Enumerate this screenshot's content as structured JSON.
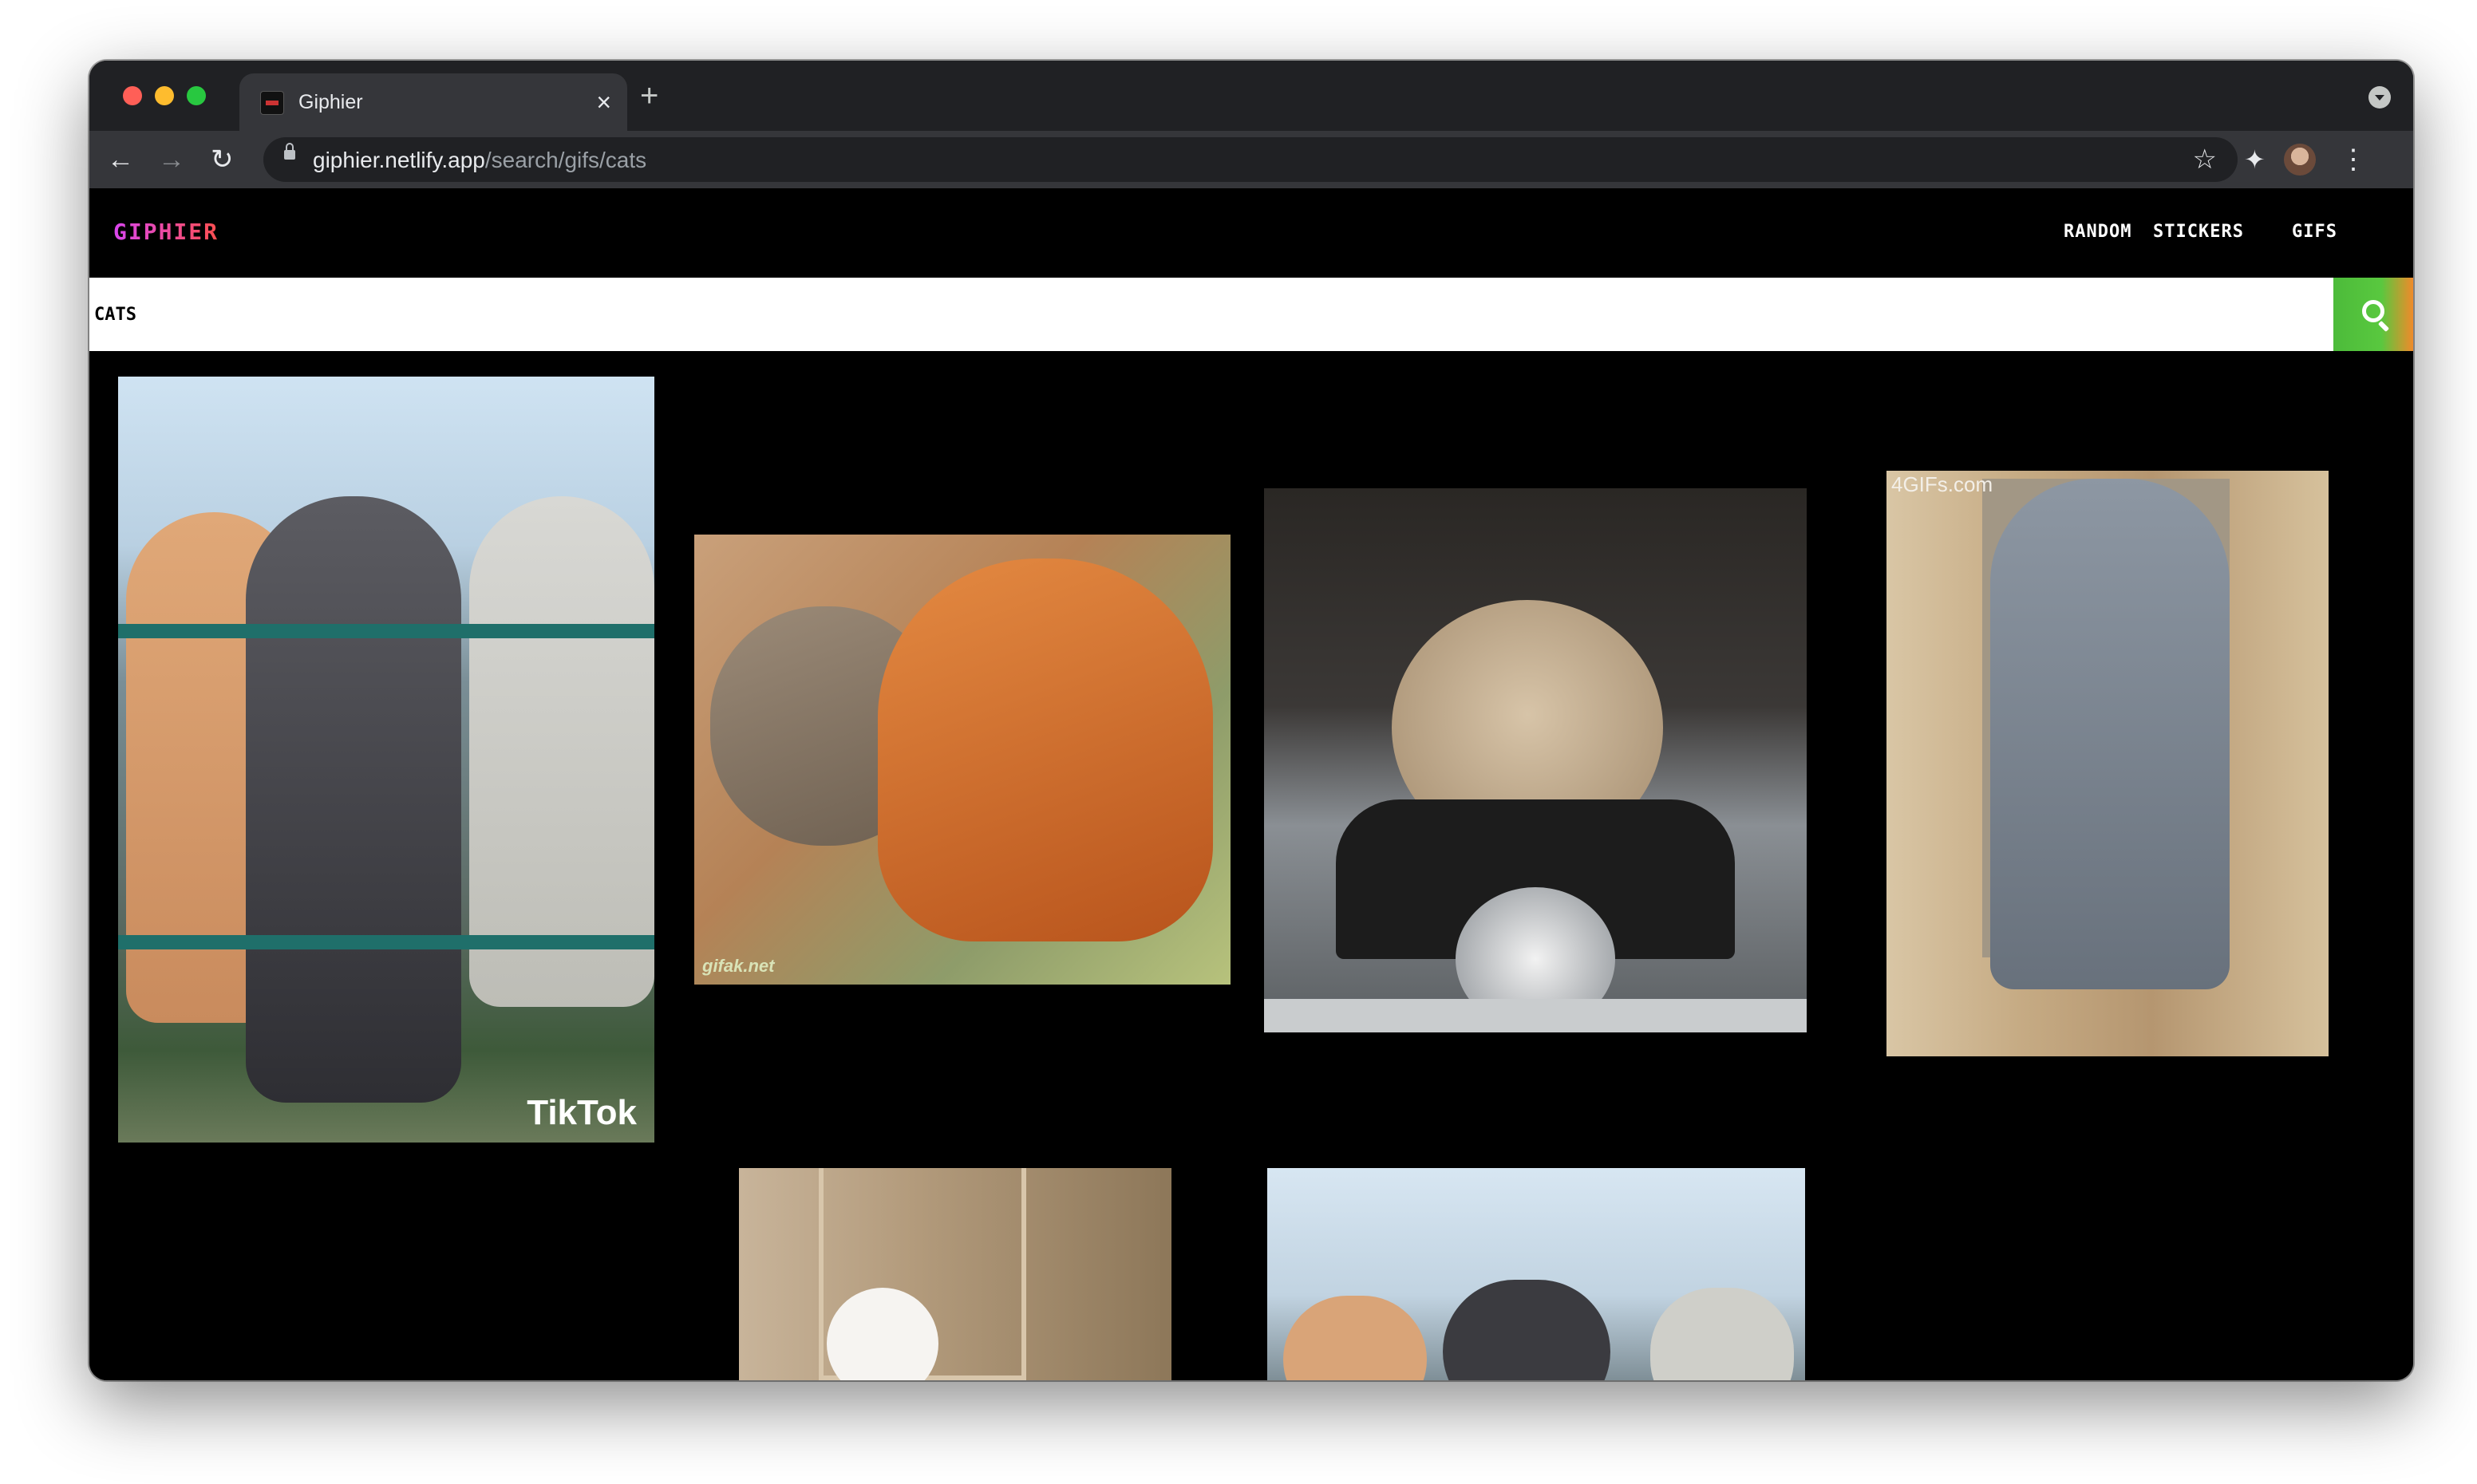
{
  "browser": {
    "tab_title": "Giphier",
    "tab_close": "×",
    "new_tab": "+",
    "url_host": "giphier.netlify.app",
    "url_path": "/search/gifs/cats",
    "icons": [
      "back-arrow-icon",
      "forward-arrow-icon",
      "reload-icon",
      "lock-icon",
      "star-icon",
      "extensions-icon",
      "menu-icon"
    ]
  },
  "app": {
    "brand": "GIPHIER",
    "nav": [
      "RANDOM",
      "STICKERS",
      "GIFS"
    ],
    "search_value": "CATS",
    "colors": {
      "brand_pink": "#d946ef",
      "brand_red": "#ff4f4f",
      "search_green": "#4cbb3a",
      "search_orange": "#f08a2a"
    }
  },
  "gifs": [
    {
      "desc": "three cats hanging on fence",
      "watermark": "TikTok"
    },
    {
      "desc": "two cats cuddling",
      "watermark": "gifak.net"
    },
    {
      "desc": "kitten riding motorcycle",
      "watermark": ""
    },
    {
      "desc": "grey cat in wooden box",
      "watermark": "4GIFs.com"
    },
    {
      "desc": "cat in cardboard box",
      "watermark": ""
    },
    {
      "desc": "cats on fence (partial)",
      "watermark": ""
    }
  ]
}
